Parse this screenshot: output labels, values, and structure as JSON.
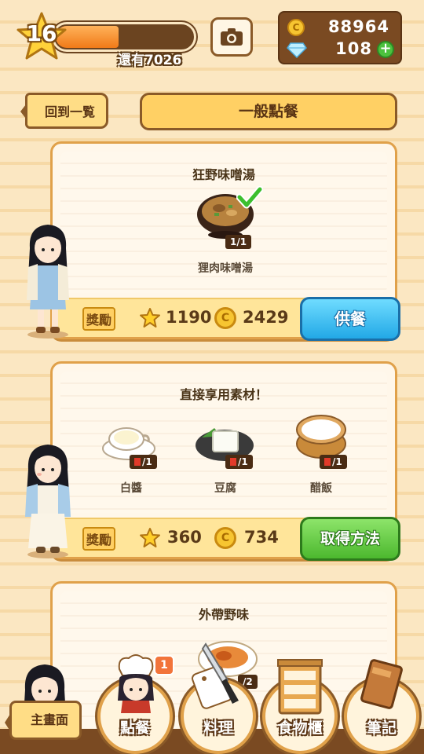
{
  "player": {
    "level": "16",
    "xp_remaining": "還有7026",
    "xp_fraction": 0.45
  },
  "currency": {
    "coins": "88964",
    "gems": "108"
  },
  "nav": {
    "back_label": "回到一覧",
    "title": "一般點餐"
  },
  "orders": [
    {
      "title": "狂野味噌湯",
      "items": [
        {
          "name": "狸肉味噌湯",
          "count": "1/1"
        }
      ],
      "reward_label": "獎勵",
      "reward_stars": "1190",
      "reward_coins": "2429",
      "action": "供餐"
    },
    {
      "title": "直接享用素材！",
      "items": [
        {
          "name": "白醬",
          "count": "/1"
        },
        {
          "name": "豆腐",
          "count": "/1"
        },
        {
          "name": "醋飯",
          "count": "/1"
        }
      ],
      "reward_label": "獎勵",
      "reward_stars": "360",
      "reward_coins": "734",
      "action": "取得方法"
    },
    {
      "title": "外帶野味",
      "items": [
        {
          "name": "",
          "count": "/2"
        }
      ]
    }
  ],
  "bottom_nav": {
    "home": "主畫面",
    "order": "點餐",
    "order_badge": "1",
    "cook": "料理",
    "pantry": "食物櫃",
    "notes": "筆記"
  },
  "colors": {
    "serve": "#22a8e6",
    "howto": "#4cb82e",
    "accent": "#e0a14a"
  }
}
